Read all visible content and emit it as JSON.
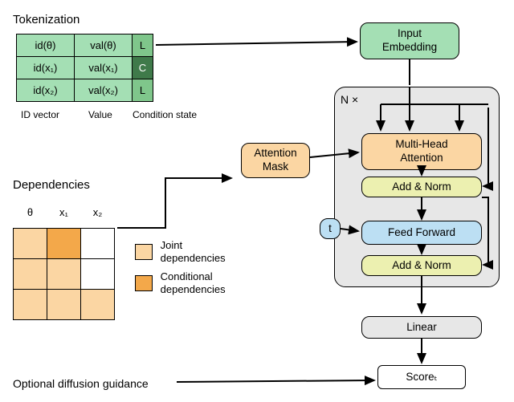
{
  "headings": {
    "tokenization": "Tokenization",
    "dependencies": "Dependencies",
    "opt_guidance": "Optional diffusion guidance"
  },
  "tokenization": {
    "rows": [
      {
        "id": "id(θ)",
        "val": "val(θ)",
        "cs": "L",
        "dark": false
      },
      {
        "id": "id(x₁)",
        "val": "val(x₁)",
        "cs": "C",
        "dark": true
      },
      {
        "id": "id(x₂)",
        "val": "val(x₂)",
        "cs": "L",
        "dark": false
      }
    ],
    "col_labels": {
      "id": "ID vector",
      "val": "Value",
      "cs": "Condition state"
    }
  },
  "dependencies": {
    "headers": [
      "θ",
      "x₁",
      "x₂"
    ],
    "grid": [
      [
        "jd",
        "cd",
        ""
      ],
      [
        "jd",
        "jd",
        ""
      ],
      [
        "jd",
        "jd",
        "jd"
      ]
    ],
    "legend": {
      "joint": "Joint\ndependencies",
      "conditional": "Conditional\ndependencies"
    }
  },
  "architecture": {
    "input_embedding": "Input\nEmbedding",
    "n_times": "N ×",
    "attention_mask": "Attention\nMask",
    "mha": "Multi-Head\nAttention",
    "addnorm1": "Add & Norm",
    "t": "t",
    "ff": "Feed Forward",
    "addnorm2": "Add & Norm",
    "linear": "Linear",
    "score": "Scoreₜ"
  }
}
